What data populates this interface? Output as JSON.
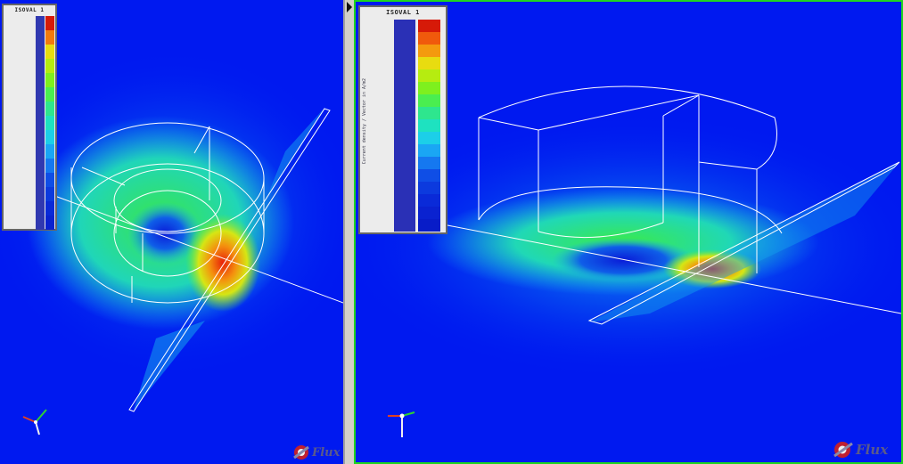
{
  "views": [
    {
      "id": "left",
      "legend": {
        "title": "ISOVAL 1",
        "side_label": "",
        "values": []
      },
      "brand": "Flux"
    },
    {
      "id": "right",
      "legend": {
        "title": "ISOVAL 1",
        "side_label": "Current density / Vector in A/m2",
        "values": []
      },
      "brand": "Flux"
    }
  ],
  "colors": {
    "background": "#0019f0",
    "right_frame": "#1fd51f",
    "colormap": [
      "#0a2ad8",
      "#0f4ee6",
      "#1578f0",
      "#1aa6f4",
      "#1ccfe8",
      "#1ee6c0",
      "#2ef08a",
      "#4af04e",
      "#7ef01e",
      "#b6ec10",
      "#e6e010",
      "#f6b00e",
      "#f2780c",
      "#e6400a",
      "#d61a08"
    ]
  }
}
